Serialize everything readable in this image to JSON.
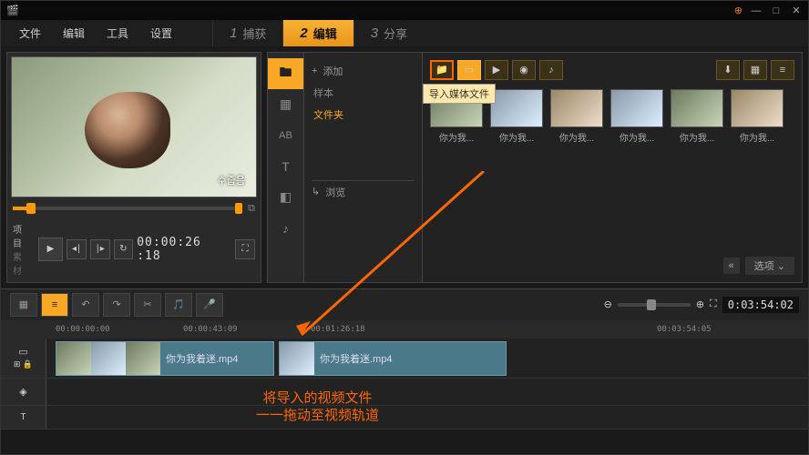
{
  "menu": {
    "file": "文件",
    "edit": "编辑",
    "tools": "工具",
    "settings": "设置"
  },
  "steps": {
    "s1n": "1",
    "s1": "捕获",
    "s2n": "2",
    "s2": "编辑",
    "s3n": "3",
    "s3": "分享"
  },
  "preview": {
    "korean": "수줍음",
    "timecode": "00:00:26 :18",
    "proj": "项目",
    "mat": "素材"
  },
  "lib": {
    "add": "添加",
    "sample": "样本",
    "folder": "文件夹",
    "browse": "浏览"
  },
  "gal": {
    "tooltip": "导入媒体文件",
    "options": "选项"
  },
  "thumbs": [
    {
      "label": "你为我..."
    },
    {
      "label": "你为我..."
    },
    {
      "label": "你为我..."
    },
    {
      "label": "你为我..."
    },
    {
      "label": "你为我..."
    },
    {
      "label": "你为我..."
    }
  ],
  "timeline": {
    "marks": [
      "00:00:00:00",
      "00:00:43:09",
      "00:01:26:18",
      "00:03:54:05"
    ],
    "total": "0:03:54:02",
    "clip1": "你为我着迷.mp4",
    "clip2": "你为我着迷.mp4"
  },
  "annotation": {
    "l1": "将导入的视频文件",
    "l2": "一一拖动至视频轨道"
  }
}
